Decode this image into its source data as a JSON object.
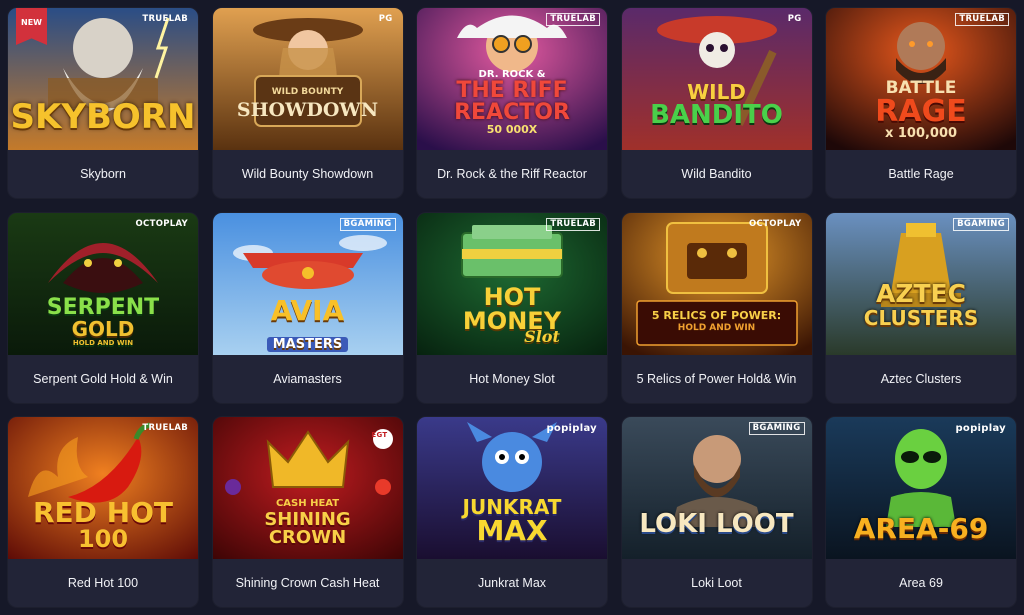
{
  "games": [
    {
      "title": "Skyborn",
      "provider": "TRUELAB",
      "badge": "NEW",
      "logo": [
        "SKYBORN"
      ],
      "colors": [
        "#f4b02a",
        "#5a3b1e",
        "#2c5a9a"
      ]
    },
    {
      "title": "Wild Bounty Showdown",
      "provider": "PG",
      "logo": [
        "WILD BOUNTY",
        "SHOWDOWN"
      ],
      "colors": [
        "#c98a3a",
        "#4a2a12",
        "#7a4a1c"
      ]
    },
    {
      "title": "Dr. Rock & the Riff Reactor",
      "provider": "TRUELAB",
      "logo": [
        "DR. ROCK &",
        "THE RIFF",
        "REACTOR",
        "50 000X"
      ],
      "colors": [
        "#e23c8c",
        "#2a0f3e",
        "#f29a2a"
      ]
    },
    {
      "title": "Wild Bandito",
      "provider": "PG",
      "logo": [
        "WILD",
        "BANDITO"
      ],
      "colors": [
        "#3fbf48",
        "#3a1a4a",
        "#d8402a"
      ]
    },
    {
      "title": "Battle Rage",
      "provider": "TRUELAB",
      "logo": [
        "BATTLE",
        "RAGE",
        "x 100,000"
      ],
      "colors": [
        "#e83a1c",
        "#2a0c08",
        "#f0a030"
      ]
    },
    {
      "title": "Serpent Gold Hold & Win",
      "provider": "OCTOPLAY",
      "logo": [
        "SERPENT",
        "GOLD",
        "HOLD AND WIN"
      ],
      "colors": [
        "#7adf3a",
        "#0e2a10",
        "#c8a22a"
      ]
    },
    {
      "title": "Aviamasters",
      "provider": "BGAMING",
      "logo": [
        "AVIA",
        "MASTERS"
      ],
      "colors": [
        "#f5a623",
        "#4a8fe0",
        "#d8402a"
      ]
    },
    {
      "title": "Hot Money Slot",
      "provider": "TRUELAB",
      "logo": [
        "HOT",
        "MONEY",
        "Slot"
      ],
      "colors": [
        "#f5c82a",
        "#0e3a1e",
        "#3fa84a"
      ]
    },
    {
      "title": "5 Relics of Power Hold& Win",
      "provider": "OCTOPLAY",
      "logo": [
        "5 RELICS OF POWER:",
        "HOLD AND WIN"
      ],
      "colors": [
        "#f5b42a",
        "#4a1a06",
        "#d03a1a"
      ]
    },
    {
      "title": "Aztec Clusters",
      "provider": "BGAMING",
      "logo": [
        "AZTEC",
        "CLUSTERS"
      ],
      "colors": [
        "#f0c038",
        "#3a2a0a",
        "#8fb0d8"
      ]
    },
    {
      "title": "Red Hot 100",
      "provider": "TRUELAB",
      "logo": [
        "RED HOT",
        "100"
      ],
      "colors": [
        "#f5c02a",
        "#5a0a08",
        "#e8301a"
      ]
    },
    {
      "title": "Shining Crown Cash Heat",
      "provider": "EGT",
      "logo": [
        "CASH HEAT",
        "SHINING",
        "CROWN"
      ],
      "colors": [
        "#f0c030",
        "#4a0808",
        "#c01820"
      ]
    },
    {
      "title": "Junkrat Max",
      "provider": "popiplay",
      "logo": [
        "JUNKRAT",
        "MAX"
      ],
      "colors": [
        "#f5d02a",
        "#1a1a4a",
        "#3a8adf"
      ]
    },
    {
      "title": "Loki Loot",
      "provider": "BGAMING",
      "logo": [
        "LOKI LOOT"
      ],
      "colors": [
        "#f0c860",
        "#1a2a3a",
        "#4a8ac8"
      ]
    },
    {
      "title": "Area 69",
      "provider": "popiplay",
      "logo": [
        "AREA-69"
      ],
      "colors": [
        "#f0a020",
        "#0a1a2a",
        "#6ad040"
      ]
    }
  ]
}
